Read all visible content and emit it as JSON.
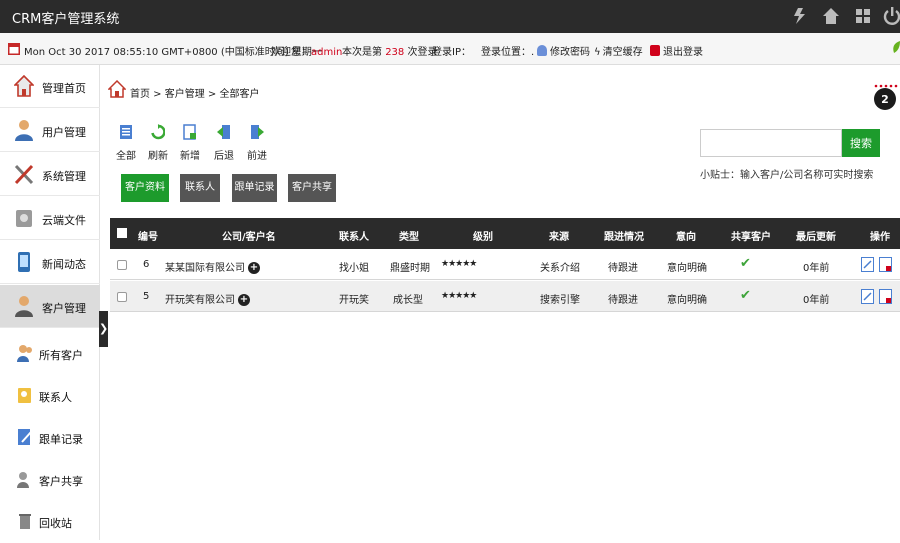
{
  "app": {
    "title": "CRM客户管理系统"
  },
  "infobar": {
    "datetime": "Mon Oct 30 2017 08:55:10 GMT+0800 (中国标准时间) 星期一",
    "welcome_prefix": "欢迎您：",
    "username": "admin",
    "login_count_prefix": "本次是第",
    "login_count": "238",
    "login_count_suffix": "次登录",
    "login_ip": "登录IP：",
    "login_location": "登录位置：.",
    "change_password": "修改密码",
    "clear_cache": "清空缓存",
    "logout": "退出登录"
  },
  "sidebar": {
    "items": [
      {
        "label": "管理首页"
      },
      {
        "label": "用户管理"
      },
      {
        "label": "系统管理"
      },
      {
        "label": "云端文件"
      },
      {
        "label": "新闻动态"
      },
      {
        "label": "客户管理"
      }
    ],
    "sub_items": [
      {
        "label": "所有客户"
      },
      {
        "label": "联系人"
      },
      {
        "label": "跟单记录"
      },
      {
        "label": "客户共享"
      },
      {
        "label": "回收站"
      }
    ],
    "collapse_glyph": "❯"
  },
  "breadcrumb": {
    "text": "首页 > 客户管理 > 全部客户"
  },
  "notification": {
    "count": "2"
  },
  "toolbar": {
    "all": "全部",
    "refresh": "刷新",
    "add": "新增",
    "back": "后退",
    "forward": "前进"
  },
  "search": {
    "button": "搜索",
    "value": "",
    "tip": "小贴士：输入客户/公司名称可实时搜索"
  },
  "tabs": [
    {
      "label": "客户资料"
    },
    {
      "label": "联系人"
    },
    {
      "label": "跟单记录"
    },
    {
      "label": "客户共享"
    }
  ],
  "table": {
    "headers": {
      "id": "编号",
      "company": "公司/客户名",
      "contact": "联系人",
      "type": "类型",
      "level": "级别",
      "source": "来源",
      "followup": "跟进情况",
      "intention": "意向",
      "shared": "共享客户",
      "last_update": "最后更新",
      "actions": "操作"
    },
    "rows": [
      {
        "id": "6",
        "company": "某某国际有限公司",
        "contact": "找小姐",
        "type": "鼎盛时期",
        "level": "★★★★★",
        "source": "关系介绍",
        "followup": "待跟进",
        "intention": "意向明确",
        "shared": "✔",
        "last_update": "0年前"
      },
      {
        "id": "5",
        "company": "开玩笑有限公司",
        "contact": "开玩笑",
        "type": "成长型",
        "level": "★★★★★",
        "source": "搜索引擎",
        "followup": "待跟进",
        "intention": "意向明确",
        "shared": "✔",
        "last_update": "0年前"
      }
    ]
  },
  "colors": {
    "accent_green": "#1d9b2c",
    "dark_bar": "#2b2b2b",
    "highlight_red": "#d0021b"
  }
}
